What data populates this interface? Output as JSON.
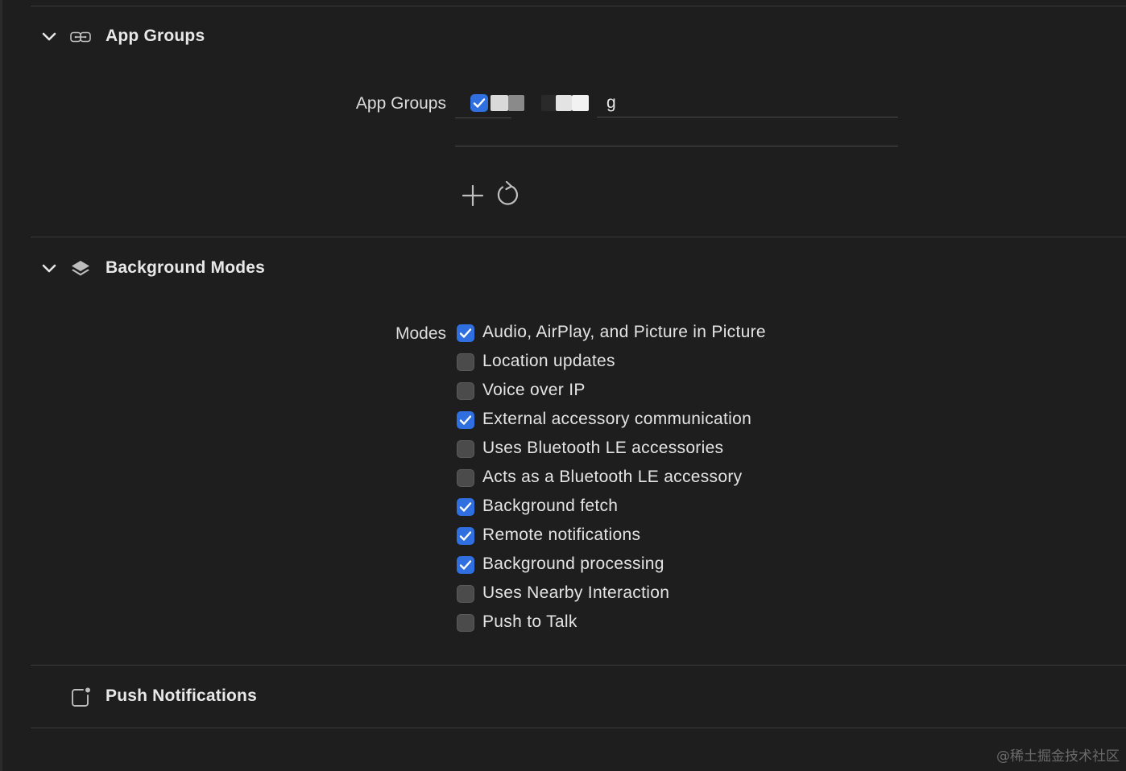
{
  "app_groups": {
    "title": "App Groups",
    "row_label": "App Groups",
    "entries": [
      {
        "checked": true,
        "value_suffix": "g"
      }
    ],
    "add_icon": "plus-icon",
    "refresh_icon": "refresh-icon"
  },
  "background_modes": {
    "title": "Background Modes",
    "row_label": "Modes",
    "modes": [
      {
        "label": "Audio, AirPlay, and Picture in Picture",
        "checked": true
      },
      {
        "label": "Location updates",
        "checked": false
      },
      {
        "label": "Voice over IP",
        "checked": false
      },
      {
        "label": "External accessory communication",
        "checked": true
      },
      {
        "label": "Uses Bluetooth LE accessories",
        "checked": false
      },
      {
        "label": "Acts as a Bluetooth LE accessory",
        "checked": false
      },
      {
        "label": "Background fetch",
        "checked": true
      },
      {
        "label": "Remote notifications",
        "checked": true
      },
      {
        "label": "Background processing",
        "checked": true
      },
      {
        "label": "Uses Nearby Interaction",
        "checked": false
      },
      {
        "label": "Push to Talk",
        "checked": false
      }
    ]
  },
  "push_notifications": {
    "title": "Push Notifications"
  },
  "watermark": "@稀土掘金技术社区",
  "colors": {
    "background": "#1e1e1e",
    "checkbox_on": "#2f6fe0",
    "checkbox_off": "#4b4b4b",
    "divider": "#3a3a3a"
  }
}
